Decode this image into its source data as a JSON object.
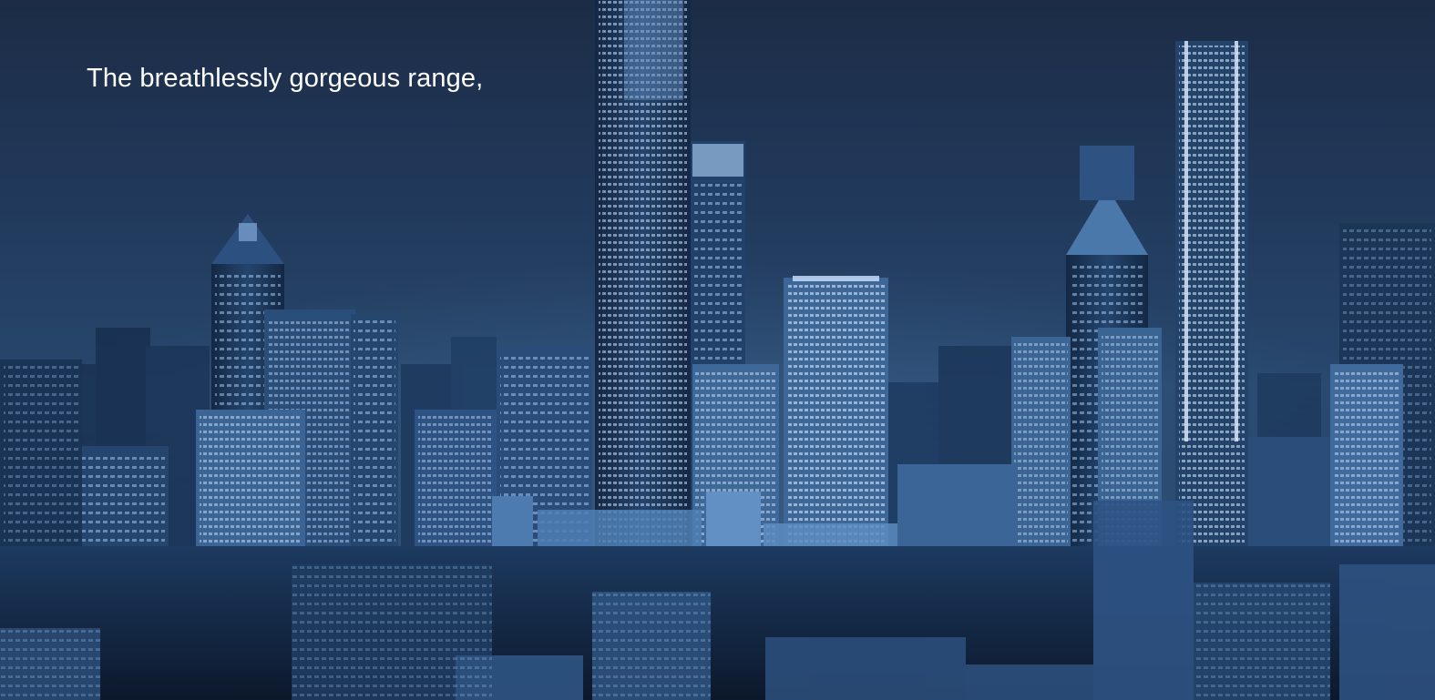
{
  "hero": {
    "headline": "The breathlessly gorgeous range,",
    "background_image": "night-city-skyline-blue-tint"
  },
  "colors": {
    "sky_top": "#1c2c46",
    "sky_mid": "#28476d",
    "building_dark": "#0f1e33",
    "building_mid": "#1f3b60",
    "building_light": "#3f6a9b",
    "window_glow": "#cfe3ff",
    "headline_text": "#ffffff"
  }
}
